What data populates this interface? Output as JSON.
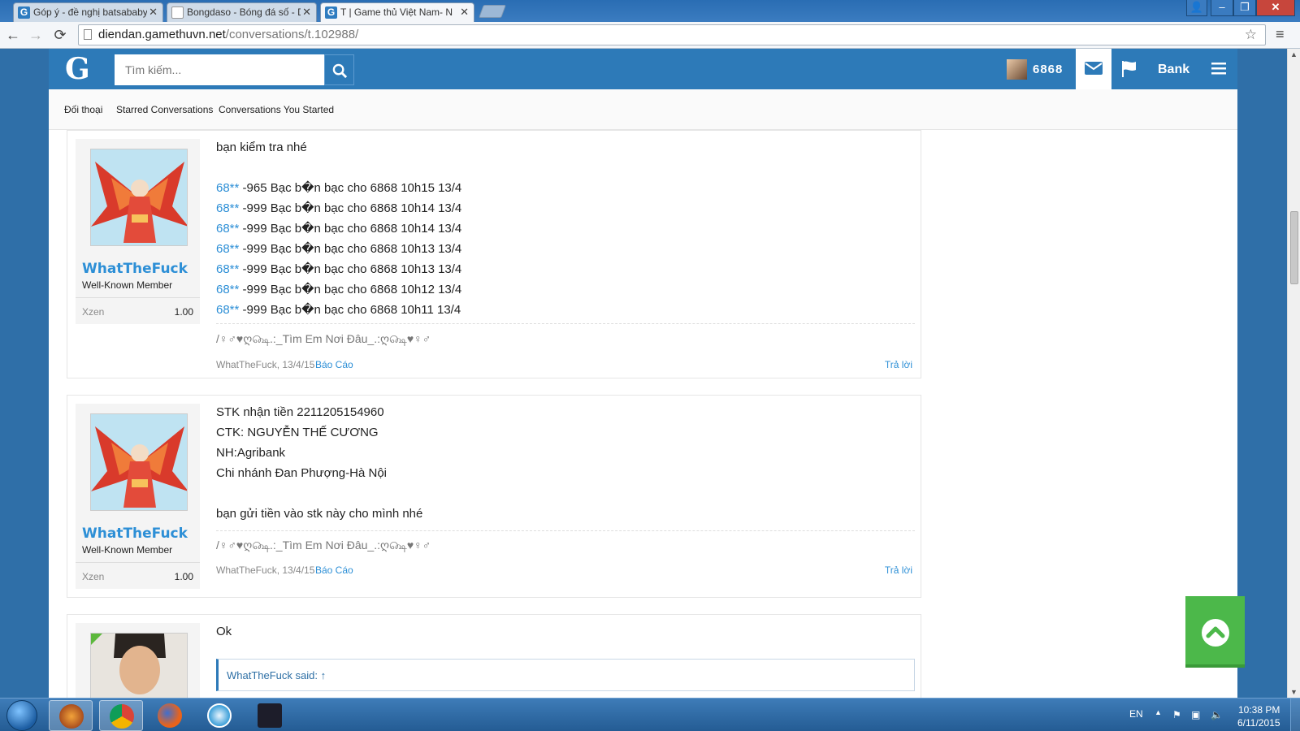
{
  "browser": {
    "tabs": [
      {
        "title": "Góp ý - đề nghị batsababy",
        "favicon": "G"
      },
      {
        "title": "Bongdaso - Bóng đá số - D",
        "favicon": ""
      },
      {
        "title": "T | Game thủ Việt Nam- N",
        "favicon": "G"
      }
    ],
    "url_host": "diendan.gamethuvn.net",
    "url_path": "/conversations/t.102988/"
  },
  "site": {
    "logo": "G",
    "search_placeholder": "Tìm kiếm...",
    "username": "6868",
    "bank_label": "Bank",
    "subnav": [
      "Đối thoại",
      "Starred Conversations",
      "Conversations You Started"
    ],
    "accent": "#2d7ab8",
    "back_to_top_color": "#4cb84a"
  },
  "messages": [
    {
      "author": "WhatTheFuck",
      "user_title": "Well-Known Member",
      "stat_key": "Xzen",
      "stat_value": "1.00",
      "intro": "bạn kiểm tra nhé",
      "transactions": [
        {
          "code": "68**",
          "text": " -965 Bạc b�n bạc cho 6868 10h15 13/4"
        },
        {
          "code": "68**",
          "text": " -999 Bạc b�n bạc cho 6868 10h14 13/4"
        },
        {
          "code": "68**",
          "text": " -999 Bạc b�n bạc cho 6868 10h14 13/4"
        },
        {
          "code": "68**",
          "text": " -999 Bạc b�n bạc cho 6868 10h13 13/4"
        },
        {
          "code": "68**",
          "text": " -999 Bạc b�n bạc cho 6868 10h13 13/4"
        },
        {
          "code": "68**",
          "text": " -999 Bạc b�n bạc cho 6868 10h12 13/4"
        },
        {
          "code": "68**",
          "text": " -999 Bạc b�n bạc cho 6868 10h11 13/4"
        }
      ],
      "signature": "/♀♂♥ღ௸.:_Tìm Em Nơi Đâu_.:ღ௸♥♀♂",
      "meta_author": "WhatTheFuck, 13/4/15",
      "report": "Báo Cáo",
      "reply": "Trả lời"
    },
    {
      "author": "WhatTheFuck",
      "user_title": "Well-Known Member",
      "stat_key": "Xzen",
      "stat_value": "1.00",
      "lines": [
        "STK nhận tiền 2211205154960",
        "CTK: NGUYỄN THẾ CƯƠNG",
        "NH:Agribank",
        "Chi nhánh Đan Phượng-Hà Nội",
        "",
        "bạn gửi tiền vào stk này cho mình nhé"
      ],
      "signature": "/♀♂♥ღ௸.:_Tìm Em Nơi Đâu_.:ღ௸♥♀♂",
      "meta_author": "WhatTheFuck, 13/4/15",
      "report": "Báo Cáo",
      "reply": "Trả lời"
    },
    {
      "text": "Ok",
      "quote_attribution": "WhatTheFuck said: ↑"
    }
  ],
  "taskbar": {
    "lang": "EN",
    "time": "10:38 PM",
    "date": "6/11/2015"
  }
}
